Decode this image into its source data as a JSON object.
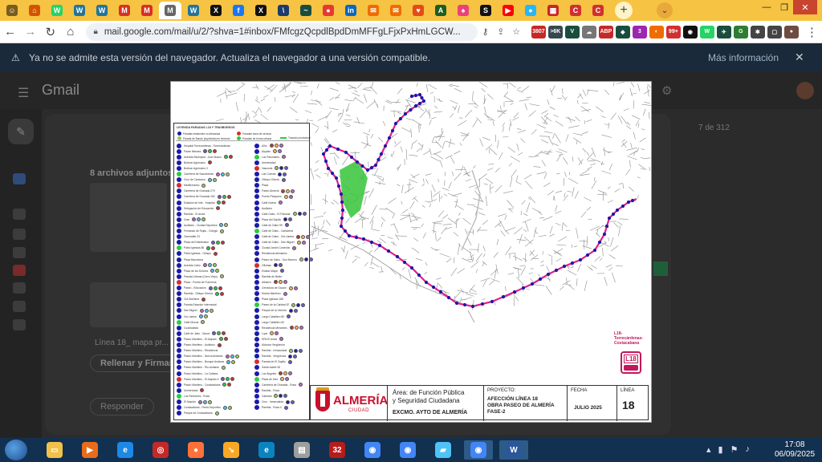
{
  "browser": {
    "url": "mail.google.com/mail/u/2/?shva=1#inbox/FMfcgzQcpdlBpdDmMFFgLFjxPxHmLGCW...",
    "tabs": [
      {
        "icon": "folder-icon",
        "color": "#7a5c1c",
        "glyph": "☺"
      },
      {
        "icon": "home-icon",
        "color": "#d35400",
        "glyph": "⌂"
      },
      {
        "icon": "whatsapp-icon",
        "color": "#25d366",
        "glyph": "W"
      },
      {
        "icon": "wordpress-icon",
        "color": "#21759b",
        "glyph": "W"
      },
      {
        "icon": "wordpress-icon",
        "color": "#21759b",
        "glyph": "W"
      },
      {
        "icon": "gmail-icon",
        "color": "#d93025",
        "glyph": "M"
      },
      {
        "icon": "gmail-icon",
        "color": "#d93025",
        "glyph": "M"
      },
      {
        "icon": "gmail-icon",
        "color": "#666666",
        "glyph": "M",
        "active": true
      },
      {
        "icon": "wordpress-icon",
        "color": "#21759b",
        "glyph": "W"
      },
      {
        "icon": "x-icon",
        "color": "#111111",
        "glyph": "X"
      },
      {
        "icon": "facebook-icon",
        "color": "#1877f2",
        "glyph": "f"
      },
      {
        "icon": "x-icon",
        "color": "#111111",
        "glyph": "X"
      },
      {
        "icon": "news-icon",
        "color": "#1d3b6e",
        "glyph": "\\"
      },
      {
        "icon": "chart-icon",
        "color": "#1b4d3e",
        "glyph": "~"
      },
      {
        "icon": "red-circle-icon",
        "color": "#e53935",
        "glyph": "●"
      },
      {
        "icon": "linkedin-icon",
        "color": "#0a66c2",
        "glyph": "in"
      },
      {
        "icon": "mail-icon",
        "color": "#ef6c00",
        "glyph": "✉"
      },
      {
        "icon": "mail-icon",
        "color": "#ef6c00",
        "glyph": "✉"
      },
      {
        "icon": "heart-icon",
        "color": "#e64a19",
        "glyph": "♥"
      },
      {
        "icon": "a-icon",
        "color": "#1b5e20",
        "glyph": "A"
      },
      {
        "icon": "pig-icon",
        "color": "#ec407a",
        "glyph": "♠"
      },
      {
        "icon": "s-icon",
        "color": "#111111",
        "glyph": "S"
      },
      {
        "icon": "youtube-icon",
        "color": "#ff0000",
        "glyph": "▶"
      },
      {
        "icon": "chat-icon",
        "color": "#29b6f6",
        "glyph": "●"
      },
      {
        "icon": "news-red-icon",
        "color": "#c62828",
        "glyph": "▦"
      },
      {
        "icon": "c-icon",
        "color": "#d32f2f",
        "glyph": "C"
      },
      {
        "icon": "c-icon",
        "color": "#d32f2f",
        "glyph": "C"
      }
    ],
    "extensions": [
      {
        "label": "3807",
        "color": "#c62828"
      },
      {
        "label": ">6K",
        "color": "#37474f"
      },
      {
        "label": "V",
        "color": "#1b4d3e"
      },
      {
        "label": "☁",
        "color": "#777777"
      },
      {
        "label": "ABP",
        "color": "#c62828"
      },
      {
        "label": "◆",
        "color": "#1b4d3e"
      },
      {
        "label": "3",
        "color": "#9c27b0"
      },
      {
        "label": "◐",
        "color": "#ef6c00"
      },
      {
        "label": "99+",
        "color": "#d32f2f"
      },
      {
        "label": "◉",
        "color": "#111111"
      },
      {
        "label": "W",
        "color": "#25d366"
      },
      {
        "label": "✈",
        "color": "#1b4d3e"
      },
      {
        "label": "G",
        "color": "#2e7d32"
      },
      {
        "label": "✱",
        "color": "#444444"
      },
      {
        "label": "▢",
        "color": "#444444"
      },
      {
        "label": "●",
        "color": "#6d4c41"
      }
    ]
  },
  "infobar": {
    "message": "Ya no se admite esta versión del navegador. Actualiza el navegador a una versión compatible.",
    "more": "Más información"
  },
  "gmail": {
    "logo": "Gmail",
    "attachments": "8 archivos adjuntos",
    "reply": "Responder",
    "fill_sign": "Rellenar y Firmar",
    "linea": "Línea 18_ mapa pr...",
    "pager": "7 de 312"
  },
  "map": {
    "legend": {
      "title": "LEYENDA   PARADAS  L18  Y TRASBORDOS",
      "top_items": [
        {
          "text": "Paradas existentes no afectadas",
          "color": "#1a1aaa",
          "kind": "dot"
        },
        {
          "text": "Paradas fuera de servicio",
          "color": "#d32f2f",
          "kind": "dot"
        },
        {
          "text": "Parada de Bando (suprimida) en terminal",
          "color": "#9ccc65",
          "kind": "dot"
        },
        {
          "text": "Paradas de forma urbana",
          "color": "#2ecc40",
          "kind": "dot"
        },
        {
          "text": "Trazado provisional",
          "color": "#2ecc40",
          "kind": "line"
        }
      ],
      "col1": [
        "Hospital Torrecárdenas - Torrecárdenas",
        "Padre Méndez",
        "Avenida Municipal - Juan Bosco",
        "Bulevar Agrónomo",
        "Bulevar Agrónomo II",
        "Carretera de Sacramento",
        "Cruz de Caravaca",
        "Mediterráneo",
        "Carretera de Granada 270",
        "Carretera de Granada 182",
        "Estación de Inte - Hospital",
        "Delegación de Educación",
        "Rambla - El Ancla",
        "Gran",
        "Auditorio - Ciudad Deportiva",
        "Fernando de Rojas - Colegio",
        "Generalife 23",
        "Plaza del Distribuidor",
        "Pablo Iglesias 88",
        "Pablo Iglesias - Obispo",
        "Plaza Barcelona",
        "Avenida Cabo",
        "Plaza de los Dolores",
        "Parada Urbana (Cerro Viejo)",
        "Plaza - Puerta de Purchena",
        "Paseo - Educación",
        "Rambla - Obispo Orberá",
        "CIA Marítima",
        "Parada Estación Intermodal",
        "San Miguel",
        "Vía Láctea",
        "Calle Murcia",
        "Cuadradista",
        "Calle de Jaén - Sauce",
        "Paseo Marítimo - El Alquián",
        "Paseo Marítimo - Auditorio",
        "Paseo Marítimo - Residencia",
        "Paseo Marítimo - Nueva Andarax",
        "Paseo Marítimo - Bosque Andarax",
        "Paseo Marítimo - Rio Andarax",
        "Paseo Marítimo - La Cañada",
        "Paseo Marítimo - El Alquián II",
        "Paseo Marítimo - Costacabana",
        "Universidad",
        "Los Partidores - Rosa",
        "El Alquián",
        "Costacabana - Penta Deportivo",
        "Parque de Costacabana"
      ],
      "col2": [
        "Alhu",
        "Alquián",
        "Los Palomares",
        "Universidad",
        "Vasconia",
        "Las Cuevas",
        "Obispo Orberá",
        "Plaza",
        "Paseo Almería",
        "Puerto Pesquero",
        "Calle Nueva",
        "Auditorio",
        "Calle Gabo - El Palomar",
        "Plaza del Zapillo",
        "Calle de Gabo 99",
        "Calle de Gabo - Cañaveral",
        "Calle de Gabo - Vía Láctea",
        "Calle de Gabo - San Miguel",
        "Ciudad Jardín Conexión",
        "Residencia Alemanes",
        "Paseo de Gabo - Son Moreno",
        "Oficinas",
        "Estado Mayor",
        "Rambla de Belén",
        "Albaicín",
        "Cerradura de Gaucín",
        "Murcia Marítimo",
        "Plaza Iglesias 188",
        "Paseo de la Caridad 87",
        "Parque de la Victoria",
        "Largo Caballero 80",
        "Largo Caballero 60",
        "Residencia Mercedes",
        "Lope",
        "SPA El Ancla",
        "Aldonza Vergüenza",
        "Rambla - Inmaculada",
        "Rambla - Vergüenza",
        "Parada de El Zapillo",
        "Santa Isabel 28",
        "Los Ángeles",
        "Plaza de Inés",
        "Carretera de Granada - Rosa",
        "Rambla - Rosa",
        "Catedral",
        "Cruz - Inmaculada",
        "Rambla - Rosa II"
      ]
    },
    "titleblock": {
      "logo": "ALMERÍA",
      "logo_sub": "CIUDAD",
      "area_line1": "Área: de Función Pública",
      "area_line2": "y Seguridad Ciudadana",
      "area_org": "EXCMO. AYTO DE ALMERÍA",
      "proyecto_label": "PROYECTO:",
      "proyecto_l1": "AFECCIÓN LÍNEA 18",
      "proyecto_l2": "OBRA PASEO DE ALMERÍA",
      "proyecto_l3": "FASE-2",
      "fecha_label": "FECHA",
      "fecha": "JULIO 2025",
      "linea_label": "LÍNEA",
      "linea": "18"
    },
    "route": {
      "label_l1": "L18-",
      "label_l2": "Torrecárdenas-",
      "label_l3": "Costacabana",
      "badge": "L18",
      "color": "#e0218a",
      "stop_color": "#1a1aaa"
    }
  },
  "taskbar": {
    "apps": [
      {
        "icon": "explorer-icon",
        "color": "#f0c14b",
        "glyph": "▭"
      },
      {
        "icon": "media-player-icon",
        "color": "#e86c1a",
        "glyph": "▶"
      },
      {
        "icon": "ie-icon",
        "color": "#1e88e5",
        "glyph": "e"
      },
      {
        "icon": "app-red-icon",
        "color": "#c62828",
        "glyph": "◎"
      },
      {
        "icon": "firefox-icon",
        "color": "#ff7139",
        "glyph": "●"
      },
      {
        "icon": "app-arrow-icon",
        "color": "#f9a825",
        "glyph": "↘"
      },
      {
        "icon": "edge-icon",
        "color": "#0a84c1",
        "glyph": "e"
      },
      {
        "icon": "printer-icon",
        "color": "#9e9e9e",
        "glyph": "▤"
      },
      {
        "icon": "app-badge-icon",
        "color": "#b71c1c",
        "glyph": "32"
      },
      {
        "icon": "chrome-icon",
        "color": "#4285f4",
        "glyph": "◉"
      },
      {
        "icon": "chrome-icon",
        "color": "#4285f4",
        "glyph": "◉"
      },
      {
        "icon": "notepad-icon",
        "color": "#4fc3f7",
        "glyph": "▰"
      },
      {
        "icon": "chrome-icon",
        "color": "#4285f4",
        "glyph": "◉",
        "active": true
      },
      {
        "icon": "word-icon",
        "color": "#2b579a",
        "glyph": "W",
        "active": true
      }
    ],
    "time": "17:08",
    "date": "06/09/2025"
  }
}
